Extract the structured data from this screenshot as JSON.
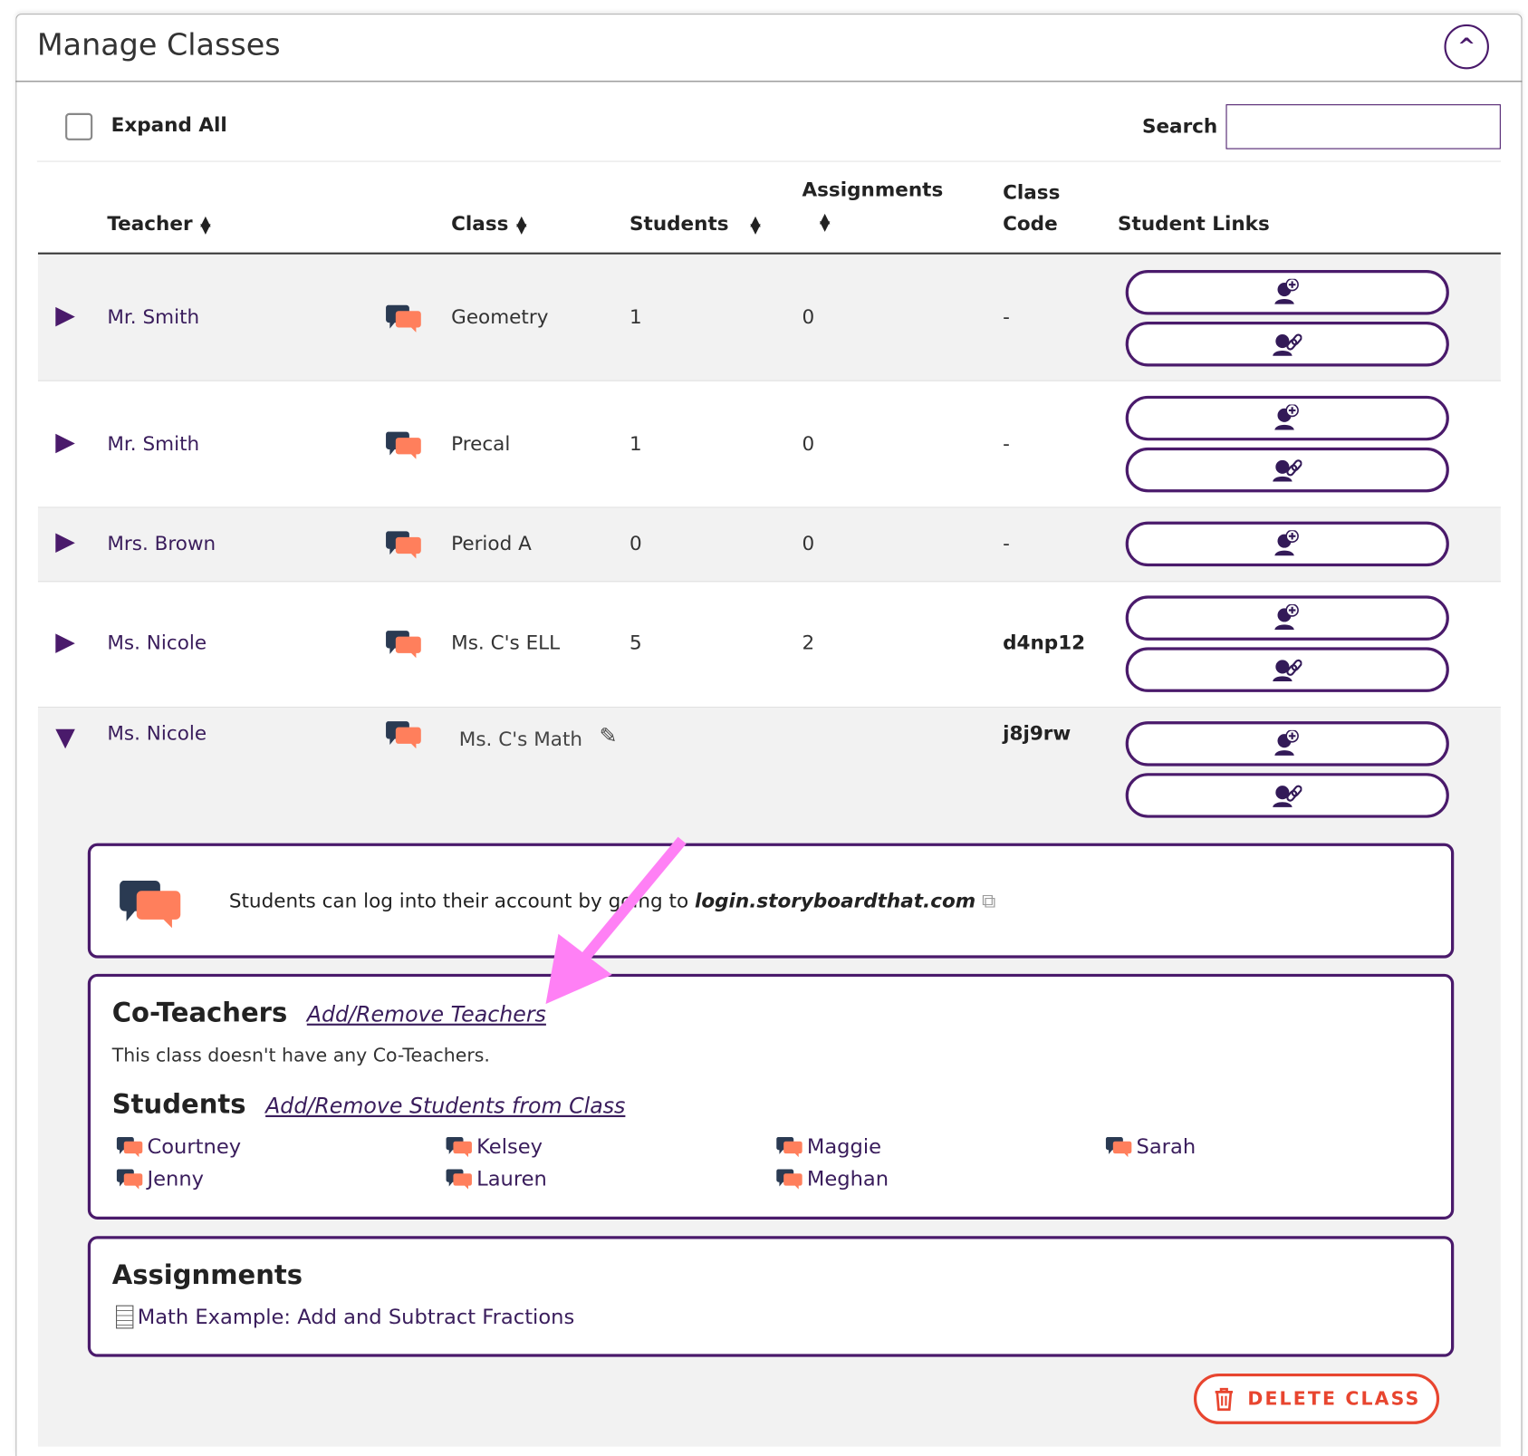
{
  "header": {
    "title": "Manage Classes",
    "collapse_label": "^"
  },
  "toolbar": {
    "expand_all": "Expand All",
    "search_label": "Search",
    "search_value": ""
  },
  "columns": {
    "teacher": "Teacher",
    "class": "Class",
    "students": "Students",
    "assignments": "Assignments",
    "class_code_1": "Class",
    "class_code_2": "Code",
    "student_links": "Student Links",
    "sort": "▲▼"
  },
  "rows": [
    {
      "teacher": "Mr. Smith",
      "class": "Geometry",
      "students": "1",
      "assignments": "0",
      "code": "-"
    },
    {
      "teacher": "Mr. Smith",
      "class": "Precal",
      "students": "1",
      "assignments": "0",
      "code": "-"
    },
    {
      "teacher": "Mrs. Brown",
      "class": "Period A",
      "students": "0",
      "assignments": "0",
      "code": "-"
    },
    {
      "teacher": "Ms. Nicole",
      "class": "Ms. C's ELL",
      "students": "5",
      "assignments": "2",
      "code": "d4np12"
    },
    {
      "teacher": "Ms. Nicole",
      "class": "Ms. C's Math",
      "students": "",
      "assignments": "",
      "code": "j8j9rw"
    }
  ],
  "expanded": {
    "login_text": "Students can log into their account by going to",
    "login_url": "login.storyboardthat.com",
    "coteachers_title": "Co-Teachers",
    "coteachers_link": "Add/Remove Teachers",
    "coteachers_empty": "This class doesn't have any Co-Teachers.",
    "students_title": "Students",
    "students_link": "Add/Remove Students from Class",
    "students": [
      "Courtney",
      "Kelsey",
      "Maggie",
      "Sarah",
      "Jenny",
      "Lauren",
      "Meghan"
    ],
    "assignments_title": "Assignments",
    "assignments": [
      "Math Example: Add and Subtract Fractions"
    ],
    "delete_label": "DELETE CLASS"
  },
  "colors": {
    "accent": "#4a1a6b",
    "danger": "#e8452f",
    "annotation": "#ff80f5",
    "chat_dark": "#2a3a52",
    "chat_orange": "#ff7f5c"
  }
}
